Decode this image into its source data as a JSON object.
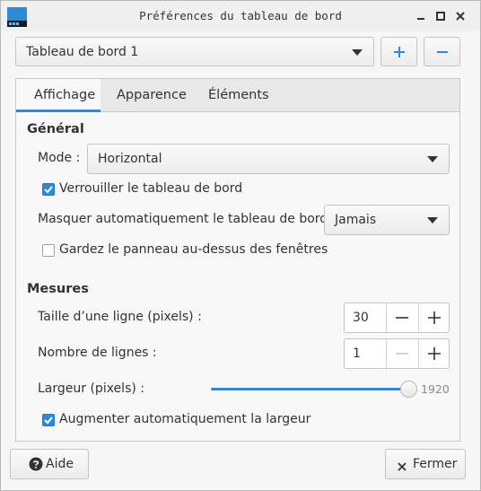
{
  "window": {
    "title": "Préférences du tableau de bord"
  },
  "panel_selector": {
    "value": "Tableau de bord 1"
  },
  "tabs": [
    {
      "label": "Affichage"
    },
    {
      "label": "Apparence"
    },
    {
      "label": "Éléments"
    }
  ],
  "general": {
    "heading": "Général",
    "mode_label": "Mode :",
    "mode_value": "Horizontal",
    "lock_label": "Verrouiller le tableau de bord",
    "lock_checked": true,
    "autohide_label": "Masquer automatiquement le tableau de bord :",
    "autohide_value": "Jamais",
    "keep_above_label": "Gardez le panneau au-dessus des fenêtres",
    "keep_above_checked": false
  },
  "measures": {
    "heading": "Mesures",
    "row_size_label": "Taille d’une ligne (pixels) :",
    "row_size_value": "30",
    "row_count_label": "Nombre de lignes :",
    "row_count_value": "1",
    "width_label": "Largeur (pixels) :",
    "width_value": "1920",
    "width_fraction": 1.0,
    "auto_width_label": "Augmenter automatiquement la largeur",
    "auto_width_checked": true
  },
  "footer": {
    "help_label": "Aide",
    "close_label": "Fermer"
  },
  "colors": {
    "accent": "#2f8ad6",
    "background": "#f6f6f6"
  }
}
